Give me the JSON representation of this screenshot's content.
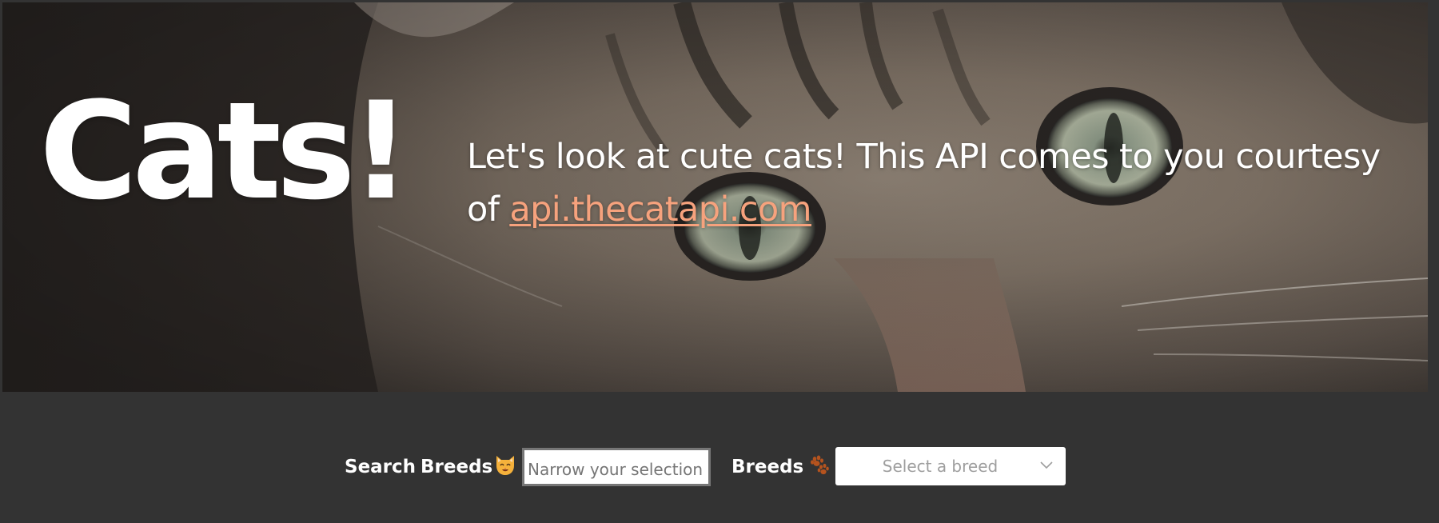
{
  "hero": {
    "title": "Cats!",
    "description_prefix": "Let's look at cute cats! This API comes to you courtesy of ",
    "link_text": "api.thecatapi.com"
  },
  "search": {
    "label_search": "Search",
    "label_breeds": "Breeds",
    "emoji_icon": "cat-face-icon",
    "placeholder": "Narrow your selection",
    "value": ""
  },
  "breeds": {
    "label": "Breeds",
    "emoji_icon": "paw-prints-icon",
    "select_placeholder": "Select a breed"
  },
  "colors": {
    "background": "#333333",
    "link": "#f6a27d",
    "text": "#ffffff"
  }
}
